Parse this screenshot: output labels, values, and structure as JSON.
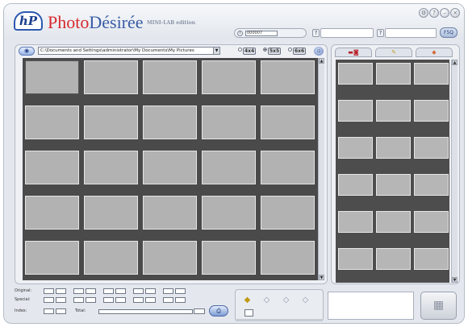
{
  "app": {
    "logo_mark": "hP",
    "name_part1": "Photo",
    "name_part2": "Désirée",
    "edition": "MINI-LAB edition"
  },
  "window_controls": [
    {
      "name": "settings",
      "glyph": "⚙"
    },
    {
      "name": "help",
      "glyph": "?"
    },
    {
      "name": "minimize",
      "glyph": "–"
    },
    {
      "name": "close",
      "glyph": "×"
    }
  ],
  "header": {
    "counter_value": "000007",
    "help_glyph": "?",
    "search_glyph": "?",
    "find_label": "F5Q"
  },
  "toolbar": {
    "path": "C:\\Documents and Settings\\administrator\\My Documents\\My Pictures",
    "grid_options": [
      {
        "label": "4x4",
        "selected": false
      },
      {
        "label": "5x5",
        "selected": true
      },
      {
        "label": "6x6",
        "selected": false
      }
    ]
  },
  "grid": {
    "columns": 5,
    "rows": 5,
    "selected_index": 1
  },
  "right_panel": {
    "tabs": [
      {
        "name": "camera",
        "glyph": "▬◙"
      },
      {
        "name": "pencil",
        "glyph": "✎"
      },
      {
        "name": "brush",
        "glyph": "◆"
      }
    ],
    "columns": 3,
    "rows": 6
  },
  "counts": {
    "original_label": "Original:",
    "special_label": "Special:",
    "index_label": "Index:",
    "total_label": "Total:",
    "size_markers": [
      "P",
      "10",
      "13",
      "15",
      "20"
    ]
  },
  "tools": [
    {
      "name": "eraser",
      "active": true
    },
    {
      "name": "diamond-1",
      "active": false
    },
    {
      "name": "diamond-2",
      "active": false
    },
    {
      "name": "diamond-3",
      "active": false
    }
  ],
  "colors": {
    "accent": "#3a5ca6",
    "brand_red": "#d8282e",
    "grid_bg": "#4a4a4a",
    "thumb": "#b2b2b2"
  }
}
